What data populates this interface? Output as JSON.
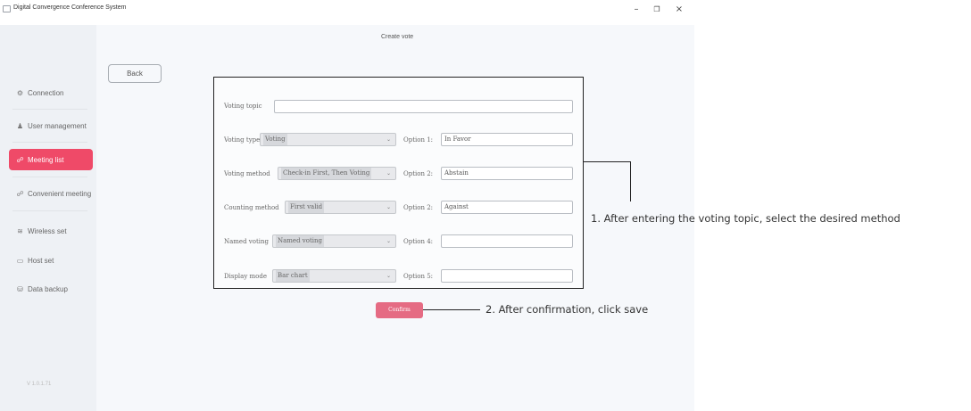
{
  "window": {
    "title": "Digital Convergence Conference System",
    "controls": {
      "minimize": "–",
      "maximize": "❐",
      "close": "×"
    }
  },
  "sidebar": {
    "items": [
      {
        "label": "Connection",
        "icon": "network-icon",
        "glyph": "⚙"
      },
      {
        "label": "User management",
        "icon": "user-icon",
        "glyph": "♟"
      },
      {
        "label": "Meeting list",
        "icon": "meeting-icon",
        "glyph": "☍",
        "active": true
      },
      {
        "label": "Convenient meeting",
        "icon": "meeting-icon",
        "glyph": "☍"
      },
      {
        "label": "Wireless set",
        "icon": "wifi-icon",
        "glyph": "≋"
      },
      {
        "label": "Host set",
        "icon": "host-icon",
        "glyph": "▭"
      },
      {
        "label": "Data backup",
        "icon": "backup-icon",
        "glyph": "⛁"
      }
    ],
    "version": "V 1.0.1.71"
  },
  "page": {
    "title": "Create vote",
    "back_label": "Back",
    "confirm_label": "Confirm"
  },
  "form": {
    "voting_topic": {
      "label": "Voting topic",
      "value": ""
    },
    "voting_type": {
      "label": "Voting type",
      "value": "Voting"
    },
    "voting_method": {
      "label": "Voting method",
      "value": "Check-in First, Then Voting"
    },
    "counting_method": {
      "label": "Counting method",
      "value": "First valid"
    },
    "named_voting": {
      "label": "Named voting",
      "value": "Named voting"
    },
    "display_mode": {
      "label": "Display mode",
      "value": "Bar chart"
    },
    "options": [
      {
        "label": "Option 1:",
        "value": "In Favor"
      },
      {
        "label": "Option 2:",
        "value": "Abstain"
      },
      {
        "label": "Option 2:",
        "value": "Against"
      },
      {
        "label": "Option 4:",
        "value": ""
      },
      {
        "label": "Option 5:",
        "value": ""
      }
    ]
  },
  "annotations": {
    "note1": "1. After entering the voting topic, select the desired method",
    "note2": "2. After confirmation, click save"
  },
  "colors": {
    "accent": "#ef4a68",
    "confirm": "#e56b83"
  }
}
